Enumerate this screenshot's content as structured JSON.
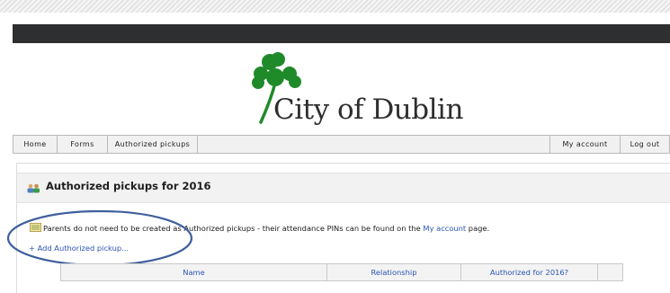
{
  "logo": {
    "text": "City of Dublin"
  },
  "nav": {
    "left": [
      "Home",
      "Forms",
      "Authorized pickups"
    ],
    "right": [
      "My account",
      "Log out"
    ]
  },
  "panel": {
    "title": "Authorized pickups for 2016",
    "info_before": "Parents do not need to be created as Authorized pickups - their attendance PINs can be found on the ",
    "info_link": "My account",
    "info_after": " page.",
    "add_link": "+ Add Authorized pickup..."
  },
  "table": {
    "columns": [
      "Name",
      "Relationship",
      "Authorized for 2016?"
    ]
  },
  "colors": {
    "dark_bar": "#2e2f30",
    "link": "#2a55b5",
    "shamrock": "#1f8a2a",
    "annotation_oval": "#3d5f9e"
  }
}
